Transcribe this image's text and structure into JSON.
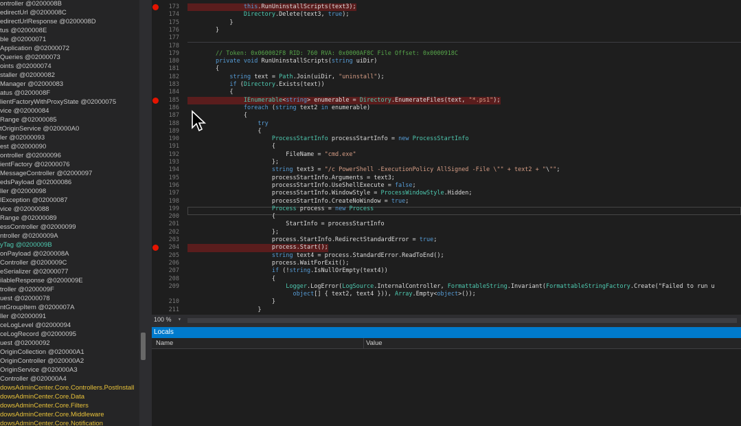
{
  "tree": {
    "items": [
      {
        "text": "ontroller @0200008B",
        "style": "normal"
      },
      {
        "text": "edirectUrl @0200008C",
        "style": "normal"
      },
      {
        "text": "edirectUrlResponse @0200008D",
        "style": "normal"
      },
      {
        "text": "tus @0200008E",
        "style": "normal"
      },
      {
        "text": "ble @02000071",
        "style": "normal"
      },
      {
        "text": "Application @02000072",
        "style": "normal"
      },
      {
        "text": "Queries @02000073",
        "style": "normal"
      },
      {
        "text": "oints @02000074",
        "style": "normal"
      },
      {
        "text": "staller @02000082",
        "style": "normal"
      },
      {
        "text": "Manager @02000083",
        "style": "normal"
      },
      {
        "text": "atus @0200008F",
        "style": "normal"
      },
      {
        "text": "lientFactoryWithProxyState @02000075",
        "style": "normal"
      },
      {
        "text": "vice @02000084",
        "style": "normal"
      },
      {
        "text": "Range @02000085",
        "style": "normal"
      },
      {
        "text": "tOriginService @020000A0",
        "style": "normal"
      },
      {
        "text": "ler @02000093",
        "style": "normal"
      },
      {
        "text": "est @02000090",
        "style": "normal"
      },
      {
        "text": "ontroller @02000096",
        "style": "normal"
      },
      {
        "text": "ientFactory @02000076",
        "style": "normal"
      },
      {
        "text": "MessageController @02000097",
        "style": "normal"
      },
      {
        "text": "edsPayload @02000086",
        "style": "normal"
      },
      {
        "text": "ller @02000098",
        "style": "normal"
      },
      {
        "text": "lException @02000087",
        "style": "normal"
      },
      {
        "text": "vice @02000088",
        "style": "normal"
      },
      {
        "text": "Range @02000089",
        "style": "normal"
      },
      {
        "text": "essController @02000099",
        "style": "normal"
      },
      {
        "text": "ntroller @0200009A",
        "style": "normal"
      },
      {
        "text": "yTag @0200009B",
        "style": "hl"
      },
      {
        "text": "onPayload @0200008A",
        "style": "normal"
      },
      {
        "text": "Controller @0200009C",
        "style": "normal"
      },
      {
        "text": "eSerializer @02000077",
        "style": "normal"
      },
      {
        "text": "ilableResponse @0200009E",
        "style": "normal"
      },
      {
        "text": "troller @0200009F",
        "style": "normal"
      },
      {
        "text": "uest @02000078",
        "style": "normal"
      },
      {
        "text": "ntGroupItem @0200007A",
        "style": "normal"
      },
      {
        "text": "ller @02000091",
        "style": "normal"
      },
      {
        "text": "ceLogLevel @02000094",
        "style": "normal"
      },
      {
        "text": "ceLogRecord @02000095",
        "style": "normal"
      },
      {
        "text": "uest @02000092",
        "style": "normal"
      },
      {
        "text": "OriginCollection @020000A1",
        "style": "normal"
      },
      {
        "text": "OriginController @020000A2",
        "style": "normal"
      },
      {
        "text": "OriginService @020000A3",
        "style": "normal"
      },
      {
        "text": "Controller @020000A4",
        "style": "normal"
      },
      {
        "text": "dowsAdminCenter.Core.Controllers.PostInstall",
        "style": "ns"
      },
      {
        "text": "dowsAdminCenter.Core.Data",
        "style": "ns"
      },
      {
        "text": "dowsAdminCenter.Core.Filters",
        "style": "ns"
      },
      {
        "text": "dowsAdminCenter.Core.Middleware",
        "style": "ns"
      },
      {
        "text": "dowsAdminCenter.Core.Notification",
        "style": "ns"
      }
    ]
  },
  "editor": {
    "lines": [
      {
        "n": "173",
        "code": "                this.RunUninstallScripts(text3);",
        "bp": true
      },
      {
        "n": "174",
        "code": "                Directory.Delete(text3, true);",
        "bp": false
      },
      {
        "n": "175",
        "code": "            }",
        "bp": false
      },
      {
        "n": "176",
        "code": "        }",
        "bp": false
      },
      {
        "n": "177",
        "code": "",
        "bp": false
      },
      {
        "n": "178",
        "code": "",
        "bp": false
      },
      {
        "n": "179",
        "code": "        // Token: 0x060002F8 RID: 760 RVA: 0x0000AF8C File Offset: 0x0000918C",
        "bp": false
      },
      {
        "n": "180",
        "code": "        private void RunUninstallScripts(string uiDir)",
        "bp": false
      },
      {
        "n": "181",
        "code": "        {",
        "bp": false
      },
      {
        "n": "182",
        "code": "            string text = Path.Join(uiDir, \"uninstall\");",
        "bp": false
      },
      {
        "n": "183",
        "code": "            if (Directory.Exists(text))",
        "bp": false
      },
      {
        "n": "184",
        "code": "            {",
        "bp": false
      },
      {
        "n": "185",
        "code": "                IEnumerable<string> enumerable = Directory.EnumerateFiles(text, \"*.ps1\");",
        "bp": true
      },
      {
        "n": "186",
        "code": "                foreach (string text2 in enumerable)",
        "bp": false
      },
      {
        "n": "187",
        "code": "                {",
        "bp": false
      },
      {
        "n": "188",
        "code": "                    try",
        "bp": false
      },
      {
        "n": "189",
        "code": "                    {",
        "bp": false
      },
      {
        "n": "190",
        "code": "                        ProcessStartInfo processStartInfo = new ProcessStartInfo",
        "bp": false
      },
      {
        "n": "191",
        "code": "                        {",
        "bp": false
      },
      {
        "n": "192",
        "code": "                            FileName = \"cmd.exe\"",
        "bp": false
      },
      {
        "n": "193",
        "code": "                        };",
        "bp": false
      },
      {
        "n": "194",
        "code": "                        string text3 = \"/c PowerShell -ExecutionPolicy AllSigned -File \\\"\" + text2 + \"\\\"\";",
        "bp": false
      },
      {
        "n": "195",
        "code": "                        processStartInfo.Arguments = text3;",
        "bp": false
      },
      {
        "n": "196",
        "code": "                        processStartInfo.UseShellExecute = false;",
        "bp": false
      },
      {
        "n": "197",
        "code": "                        processStartInfo.WindowStyle = ProcessWindowStyle.Hidden;",
        "bp": false
      },
      {
        "n": "198",
        "code": "                        processStartInfo.CreateNoWindow = true;",
        "bp": false
      },
      {
        "n": "199",
        "code": "                        Process process = new Process",
        "bp": false
      },
      {
        "n": "200",
        "code": "                        {",
        "bp": false
      },
      {
        "n": "201",
        "code": "                            StartInfo = processStartInfo",
        "bp": false
      },
      {
        "n": "202",
        "code": "                        };",
        "bp": false
      },
      {
        "n": "203",
        "code": "                        process.StartInfo.RedirectStandardError = true;",
        "bp": false
      },
      {
        "n": "204",
        "code": "                        process.Start();",
        "bp": true
      },
      {
        "n": "205",
        "code": "                        string text4 = process.StandardError.ReadToEnd();",
        "bp": false
      },
      {
        "n": "206",
        "code": "                        process.WaitForExit();",
        "bp": false
      },
      {
        "n": "207",
        "code": "                        if (!string.IsNullOrEmpty(text4))",
        "bp": false
      },
      {
        "n": "208",
        "code": "                        {",
        "bp": false
      },
      {
        "n": "209",
        "code": "                            Logger.LogError(LogSource.InternalController, FormattableString.Invariant(FormattableStringFactory.Create(\"Failed to run u",
        "bp": false
      },
      {
        "n": "",
        "code": "                              object[] { text2, text4 })), Array.Empty<object>());",
        "bp": false
      },
      {
        "n": "210",
        "code": "                        }",
        "bp": false
      },
      {
        "n": "211",
        "code": "                    }",
        "bp": false
      }
    ],
    "zoom": "100 %"
  },
  "locals": {
    "title": "Locals",
    "col_name": "Name",
    "col_value": "Value"
  },
  "colors": {
    "accent": "#007acc",
    "breakpoint": "#e51400",
    "namespace": "#e8c23a"
  }
}
